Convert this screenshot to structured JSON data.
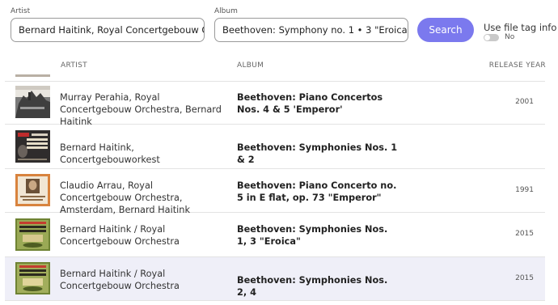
{
  "search": {
    "artist_label": "Artist",
    "artist_value": "Bernard Haitink, Royal Concertgebouw Orchestra",
    "album_label": "Album",
    "album_value": "Beethoven: Symphony no. 1 • 3 \"Eroica\"",
    "button_label": "Search",
    "file_tag_label": "Use file tag info",
    "file_tag_state": "No"
  },
  "table": {
    "headers": {
      "artist": "ARTIST",
      "album": "ALBUM",
      "year": "RELEASE YEAR"
    },
    "rows": [
      {
        "artist": "Murray Perahia, Royal Concertgebouw Orchestra, Bernard Haitink",
        "album": "Beethoven: Piano Concertos Nos. 4 & 5 'Emperor'",
        "year": "2001",
        "cover": "grayscale-castle-photo-cover",
        "cover_color": "#8a8a8a"
      },
      {
        "artist": "Bernard Haitink, Concertgebouworkest",
        "album": "Beethoven: Symphonies Nos. 1 & 2",
        "year": "",
        "cover": "dark-beethoven-title-cover",
        "cover_color": "#3b3838"
      },
      {
        "artist": "Claudio Arrau, Royal Concertgebouw Orchestra, Amsterdam, Bernard Haitink",
        "album": "Beethoven: Piano Concerto no. 5 in E flat, op. 73 \"Emperor\"",
        "year": "1991",
        "cover": "orange-portrait-cover",
        "cover_color": "#d9813a"
      },
      {
        "artist": "Bernard Haitink / Royal Concertgebouw Orchestra",
        "album": "Beethoven: Symphonies Nos. 1, 3 \"Eroica\"",
        "year": "2015",
        "cover": "green-beethoven-title-cover",
        "cover_color": "#7d8f3c"
      },
      {
        "artist": "Bernard Haitink / Royal Concertgebouw Orchestra",
        "album": "Beethoven: Symphonies Nos. 2, 4",
        "year": "2015",
        "cover": "green-beethoven-title-cover",
        "cover_color": "#7d8f3c",
        "selected": true
      }
    ]
  },
  "colors": {
    "accent": "#7b79ee",
    "selected_row": "#efeff8",
    "divider": "#e3e3e3"
  }
}
